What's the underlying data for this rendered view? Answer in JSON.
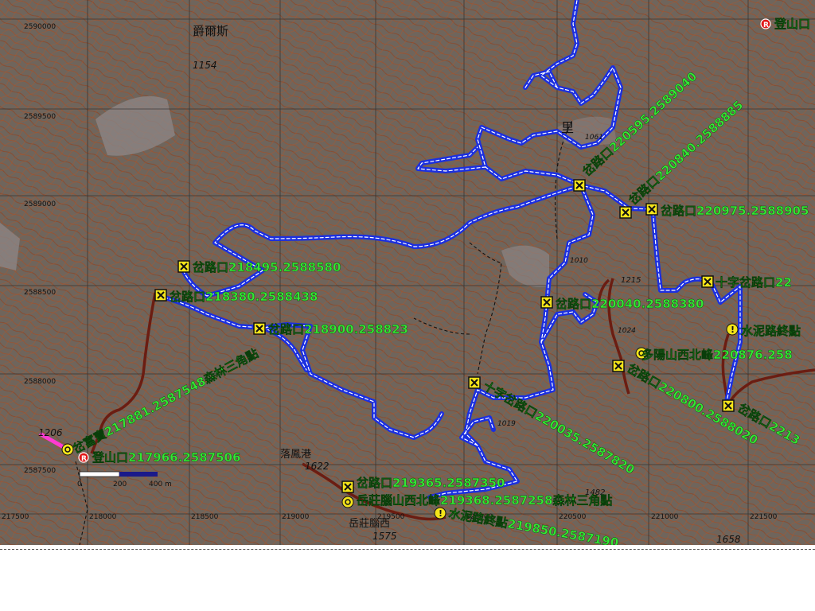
{
  "map": {
    "place_names": [
      "爵爾斯",
      "里",
      "落鳳港",
      "岳莊腦西"
    ],
    "elevations": [
      "1154",
      "1206",
      "1622",
      "1575",
      "1658",
      "1482",
      "1215",
      "1024",
      "1010",
      "1019",
      "1061"
    ],
    "grid_y_labels": [
      "2590000",
      "2589500",
      "2589000",
      "2588500",
      "2588000",
      "2587500"
    ],
    "grid_x_labels": [
      "217500",
      "218000",
      "218500",
      "219000",
      "219500",
      "220000",
      "220500",
      "221000",
      "221500"
    ],
    "scale_bar": {
      "labels": [
        "0",
        "200",
        "400 m"
      ]
    },
    "waypoints": [
      {
        "type": "fork",
        "label": "岔路口220595.2589040"
      },
      {
        "type": "fork",
        "label": "岔路口220840.2588885"
      },
      {
        "type": "fork",
        "label": "岔路口220975.2588905"
      },
      {
        "type": "fork",
        "label": "岔路口218495.2588580"
      },
      {
        "type": "fork",
        "label": "岔路口218380.2588438"
      },
      {
        "type": "fork",
        "label": "岔路口218900.258823"
      },
      {
        "type": "fork",
        "label": "十字岔路口22"
      },
      {
        "type": "fork",
        "label": "岔路口220040.2588380"
      },
      {
        "type": "warn",
        "label": "水泥路終點"
      },
      {
        "type": "peak",
        "label": "多陽山西北峰220876.258"
      },
      {
        "type": "fork",
        "label": "岔路口220800.2588020"
      },
      {
        "type": "fork",
        "label": "岔路口2213"
      },
      {
        "type": "fork",
        "label": "十字岔路口220035.2587820"
      },
      {
        "type": "peak",
        "label": "岔富寶217881.2587548森林三角點"
      },
      {
        "type": "start",
        "label": "登山口217966.2587506"
      },
      {
        "type": "fork",
        "label": "岔路口219365.2587350"
      },
      {
        "type": "peak",
        "label": "岳莊腦山西北峰219368.2587258森林三角點"
      },
      {
        "type": "warn",
        "label": "水泥路終點219850.2587190"
      },
      {
        "type": "start",
        "label": "登山口"
      }
    ]
  },
  "colors": {
    "terrain": "#6f655c",
    "contour": "#a0512c",
    "track": "#1b2fe0",
    "track_highlight": "#ffffff",
    "label": "#34e834",
    "fork_marker": "#f4e41a",
    "grid": "#2a2a2a",
    "road": "#6b1d12",
    "trail_pink": "#ff3bd2"
  }
}
